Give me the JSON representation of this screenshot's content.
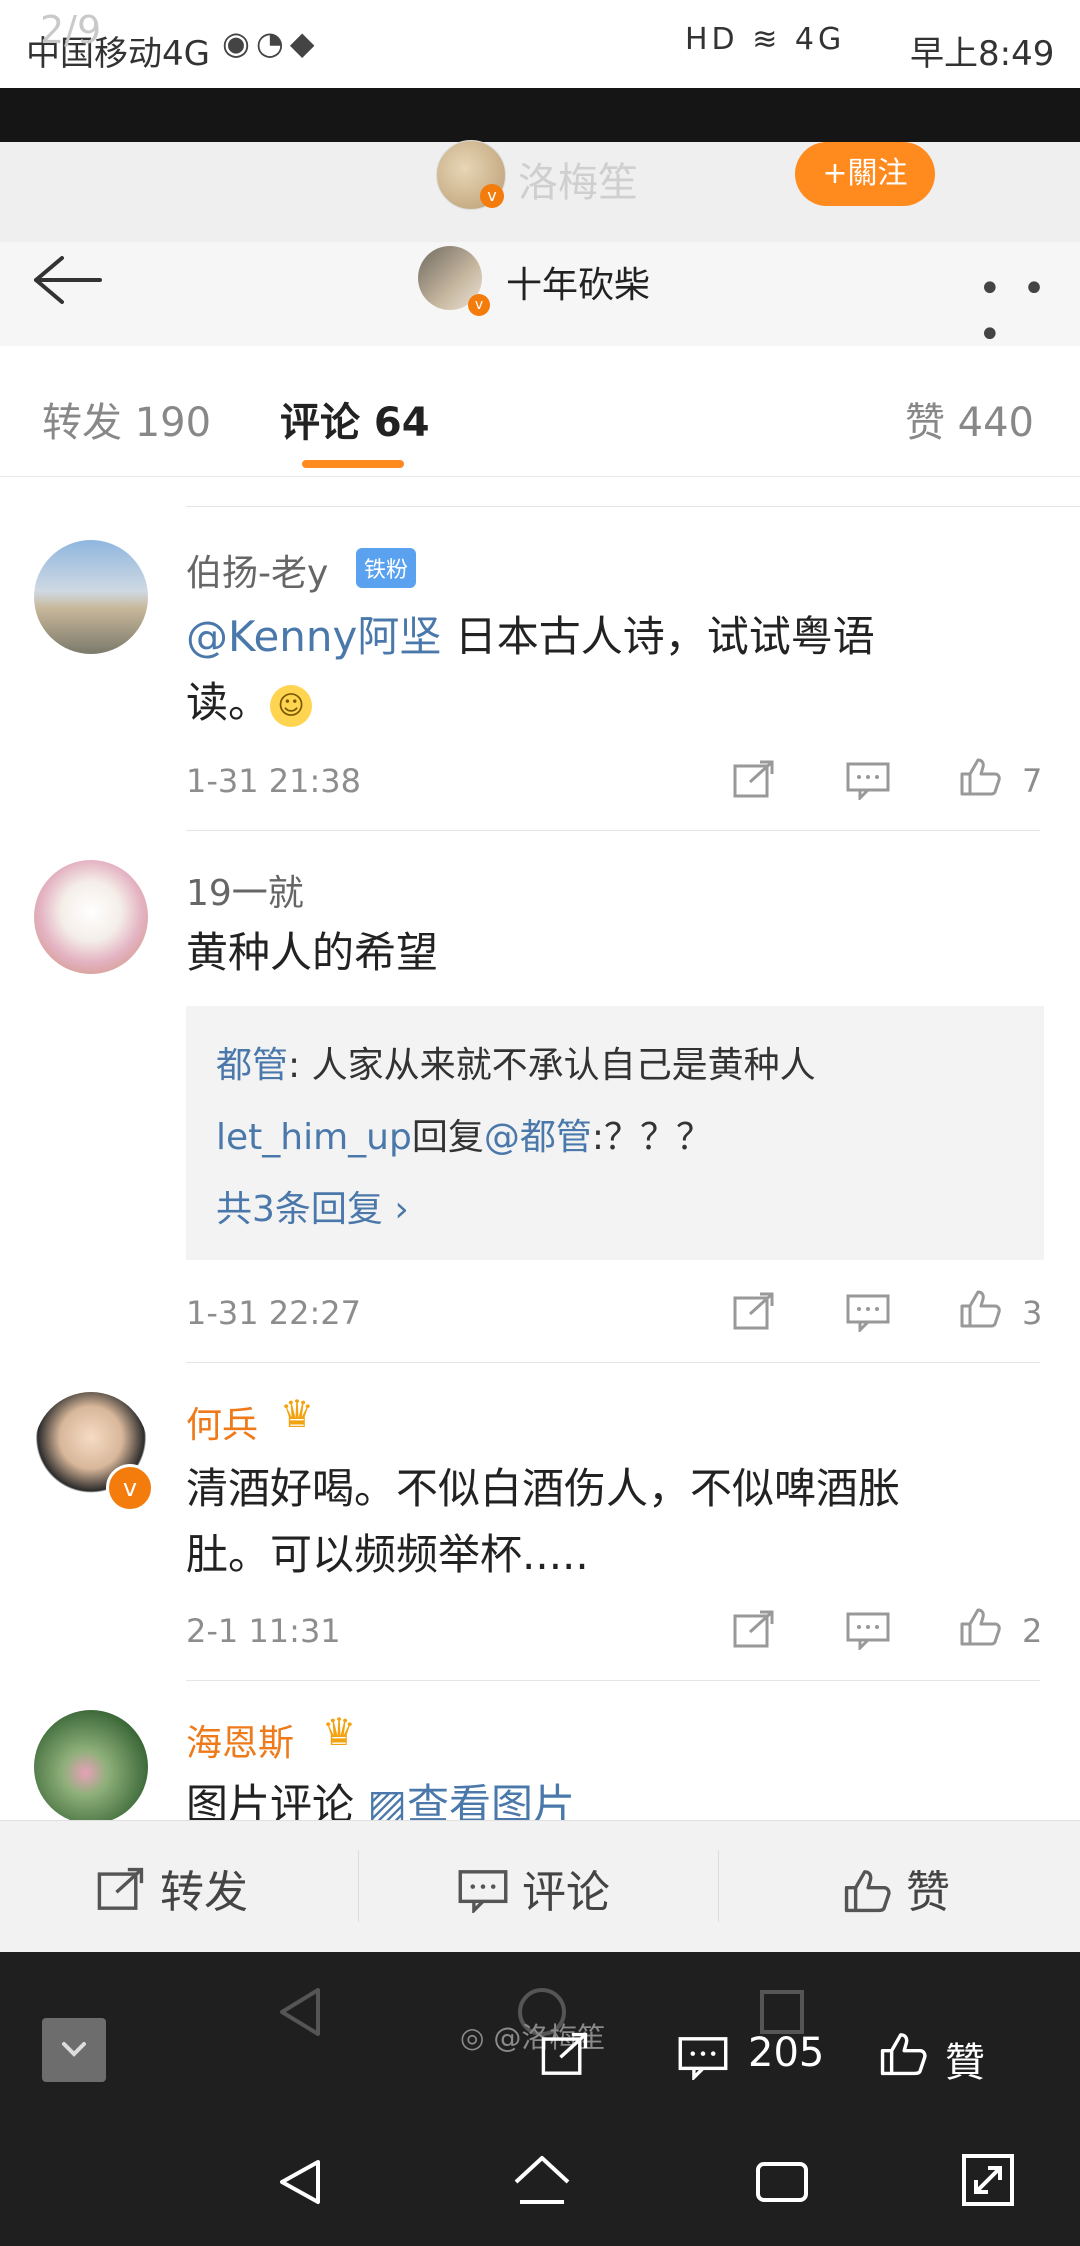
{
  "status_bar": {
    "pager": "2/9",
    "carrier": "中国移动4G",
    "time": "早上8:49",
    "right_icons": "HD ≋ 4G"
  },
  "watermark": {
    "name": "洛梅笙",
    "follow_label": "+關注"
  },
  "nav": {
    "title": "十年砍柴",
    "more": "• • •"
  },
  "tabs": {
    "repost": "转发 190",
    "comment": "评论 64",
    "like": "赞 440"
  },
  "comments": [
    {
      "name": "伯扬-老y",
      "badge": "铁粉",
      "mention": "@Kenny阿坚",
      "text_line1": " 日本古人诗，试试粤语",
      "text_line2": "读。",
      "time": "1-31 21:38",
      "likes": "7"
    },
    {
      "name": "19一就",
      "text": "黄种人的希望",
      "reply1_user": "都管",
      "reply1_text": ": 人家从来就不承认自己是黄种人",
      "reply2_user": "let_him_up",
      "reply2_mid": "回复",
      "reply2_mention": "@都管",
      "reply2_text": ":？？？",
      "more_replies": "共3条回复 ›",
      "time": "1-31 22:27",
      "likes": "3"
    },
    {
      "name": "何兵",
      "text_line1": "清酒好喝。不似白酒伤人，不似啤酒胀",
      "text_line2": "肚。可以频频举杯.....",
      "time": "2-1 11:31",
      "likes": "2"
    },
    {
      "name": "海恩斯",
      "text_prefix": "图片评论 ",
      "link": "查看图片"
    }
  ],
  "action_bar": {
    "repost": "转发",
    "comment": "评论",
    "like": "赞"
  },
  "overlay": {
    "weibo_handle": "@洛梅笙",
    "comment_count": "205",
    "praise": "贊"
  }
}
